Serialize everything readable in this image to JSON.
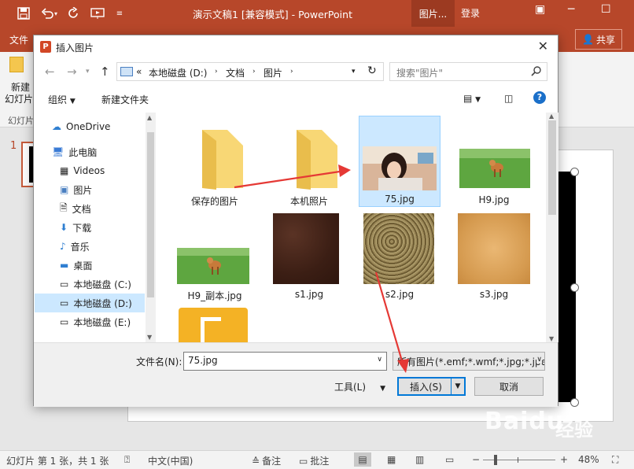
{
  "app": {
    "title": "演示文稿1 [兼容模式] - PowerPoint",
    "context_tab": "图片...",
    "login": "登录",
    "file_tab": "文件",
    "share": "共享",
    "ribbon_new": "新建",
    "ribbon_new2": "幻灯片",
    "ribbon_group": "幻灯片",
    "slide_number": "1",
    "accent": "#b7472a"
  },
  "status": {
    "slide_info": "幻灯片 第 1 张，共 1 张",
    "language": "中文(中国)",
    "notes": "备注",
    "comments": "批注",
    "zoom": "48%"
  },
  "dialog": {
    "title": "插入图片",
    "address": [
      "本地磁盘 (D:)",
      "文档",
      "图片"
    ],
    "address_prefix": "«",
    "search_placeholder": "搜索\"图片\"",
    "organize": "组织",
    "new_folder": "新建文件夹",
    "nav": [
      {
        "label": "OneDrive",
        "icon": "cloud-icon"
      },
      {
        "label": "此电脑",
        "icon": "computer-icon"
      },
      {
        "label": "Videos",
        "icon": "video-icon"
      },
      {
        "label": "图片",
        "icon": "picture-icon"
      },
      {
        "label": "文档",
        "icon": "document-icon"
      },
      {
        "label": "下载",
        "icon": "download-icon"
      },
      {
        "label": "音乐",
        "icon": "music-icon"
      },
      {
        "label": "桌面",
        "icon": "desktop-icon"
      },
      {
        "label": "本地磁盘 (C:)",
        "icon": "drive-icon"
      },
      {
        "label": "本地磁盘 (D:)",
        "icon": "drive-icon",
        "selected": true
      },
      {
        "label": "本地磁盘 (E:)",
        "icon": "drive-icon"
      }
    ],
    "files": [
      {
        "name": "保存的图片",
        "kind": "folder"
      },
      {
        "name": "本机照片",
        "kind": "folder"
      },
      {
        "name": "75.jpg",
        "kind": "photo-girl",
        "selected": true
      },
      {
        "name": "H9.jpg",
        "kind": "photo-dog"
      },
      {
        "name": "H9_副本.jpg",
        "kind": "photo-dog"
      },
      {
        "name": "s1.jpg",
        "kind": "texture-dark"
      },
      {
        "name": "s2.jpg",
        "kind": "texture-gravel"
      },
      {
        "name": "s3.jpg",
        "kind": "texture-sand"
      },
      {
        "name": "",
        "kind": "music-folder"
      }
    ],
    "filename_label": "文件名(N):",
    "filename_value": "75.jpg",
    "filetype_value": "所有图片(*.emf;*.wmf;*.jpg;*.jpeg",
    "tools": "工具(L)",
    "insert": "插入(S)",
    "cancel": "取消"
  },
  "watermark": {
    "brand": "Baidu",
    "sub": "经验"
  }
}
